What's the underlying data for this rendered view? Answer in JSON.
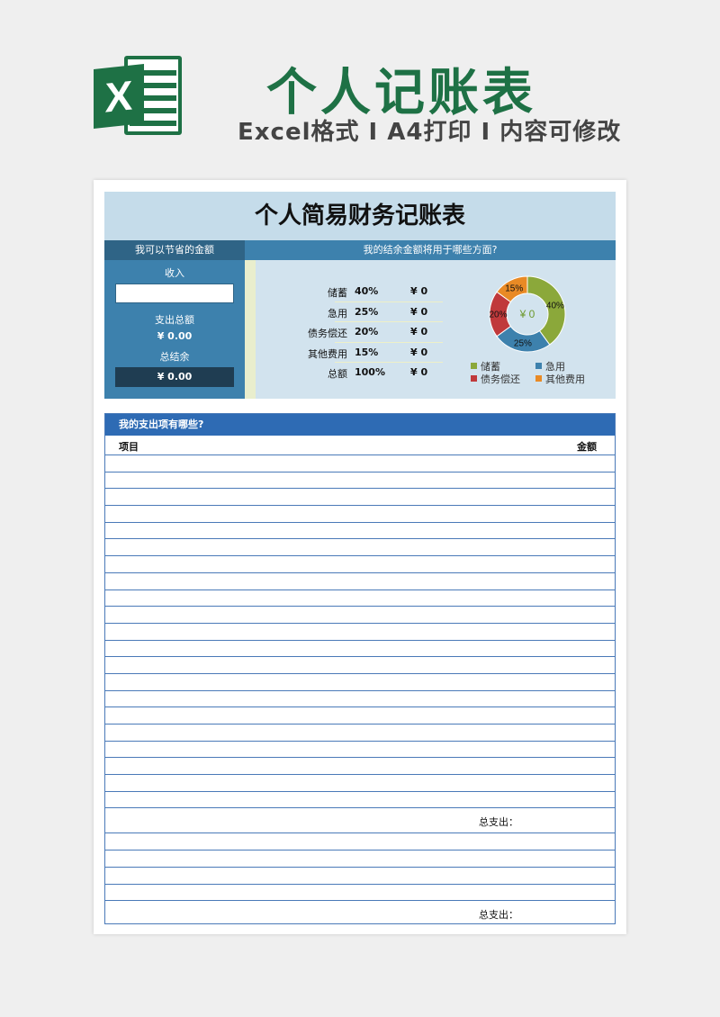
{
  "header": {
    "title": "个人记账表",
    "subtitle": "Excel格式 I A4打印 I 内容可修改",
    "logo_letter": "X"
  },
  "summary": {
    "title": "个人简易财务记账表",
    "left_header": "我可以节省的金额",
    "income_label": "收入",
    "expense_total_label": "支出总额",
    "expense_total_value": "¥ 0.00",
    "balance_label": "总结余",
    "balance_value": "¥ 0.00",
    "right_header": "我的结余金额将用于哪些方面?",
    "categories": [
      {
        "name": "储蓄",
        "percent": "40%",
        "amount": "¥ 0"
      },
      {
        "name": "急用",
        "percent": "25%",
        "amount": "¥ 0"
      },
      {
        "name": "债务偿还",
        "percent": "20%",
        "amount": "¥ 0"
      },
      {
        "name": "其他费用",
        "percent": "15%",
        "amount": "¥ 0"
      },
      {
        "name": "总额",
        "percent": "100%",
        "amount": "¥ 0"
      }
    ]
  },
  "chart_data": {
    "type": "pie",
    "center_label": "¥ 0",
    "categories": [
      "储蓄",
      "急用",
      "债务偿还",
      "其他费用"
    ],
    "values": [
      40,
      25,
      20,
      15
    ],
    "value_labels": [
      "40%",
      "25%",
      "20%",
      "15%"
    ],
    "colors": [
      "#8ba83a",
      "#3d81ad",
      "#c0393b",
      "#e98a25"
    ],
    "legend_placement": "bottom"
  },
  "expenses": {
    "header": "我的支出项有哪些?",
    "col_item": "项目",
    "col_amount": "金额",
    "subtotal_label_1": "总支出：",
    "subtotal_label_2": "总支出："
  }
}
